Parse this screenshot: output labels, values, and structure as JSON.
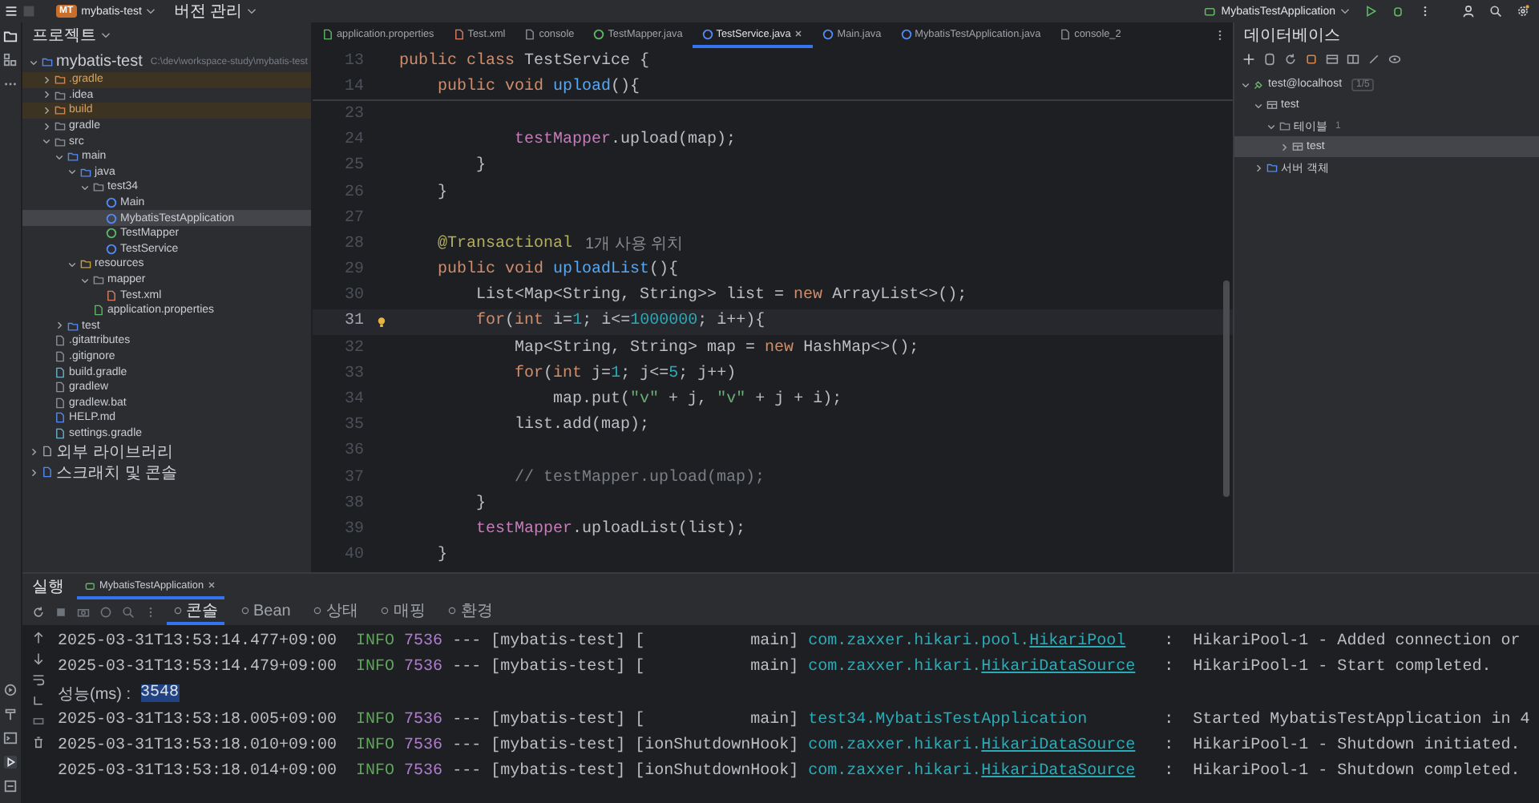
{
  "titlebar": {
    "project_badge": "MT",
    "project_name": "mybatis-test",
    "vcs": "버전 관리",
    "run_config": "MybatisTestApplication"
  },
  "project_panel": {
    "title": "프로젝트",
    "tree": [
      {
        "label": "mybatis-test",
        "hint": "C:\\dev\\workspace-study\\mybatis-test",
        "kind": "module",
        "expanded": true,
        "selected": false,
        "children": [
          {
            "label": ".gradle",
            "kind": "folder",
            "expanded": false,
            "selected": false,
            "excluded": true
          },
          {
            "label": ".idea",
            "kind": "folder",
            "expanded": false,
            "selected": false,
            "excluded": false
          },
          {
            "label": "build",
            "kind": "folder",
            "expanded": false,
            "selected": false,
            "excluded": true
          },
          {
            "label": "gradle",
            "kind": "folder",
            "expanded": false,
            "selected": false,
            "excluded": false
          },
          {
            "label": "src",
            "kind": "folder",
            "expanded": true,
            "selected": false,
            "excluded": false,
            "children": [
              {
                "label": "main",
                "kind": "module",
                "expanded": true,
                "selected": false,
                "children": [
                  {
                    "label": "java",
                    "kind": "source",
                    "expanded": true,
                    "selected": false,
                    "children": [
                      {
                        "label": "test34",
                        "kind": "package",
                        "expanded": true,
                        "selected": false,
                        "children": [
                          {
                            "label": "Main",
                            "kind": "class",
                            "selected": false
                          },
                          {
                            "label": "MybatisTestApplication",
                            "kind": "class",
                            "selected": true
                          },
                          {
                            "label": "TestMapper",
                            "kind": "interface",
                            "selected": false
                          },
                          {
                            "label": "TestService",
                            "kind": "class",
                            "selected": false
                          }
                        ]
                      }
                    ]
                  },
                  {
                    "label": "resources",
                    "kind": "resources",
                    "expanded": true,
                    "selected": false,
                    "children": [
                      {
                        "label": "mapper",
                        "kind": "folder",
                        "expanded": true,
                        "selected": false,
                        "children": [
                          {
                            "label": "Test.xml",
                            "kind": "xml",
                            "selected": false
                          }
                        ]
                      },
                      {
                        "label": "application.properties",
                        "kind": "properties",
                        "selected": false
                      }
                    ]
                  }
                ]
              },
              {
                "label": "test",
                "kind": "module",
                "expanded": false,
                "selected": false
              }
            ]
          },
          {
            "label": ".gitattributes",
            "kind": "file",
            "selected": false,
            "excluded": false
          },
          {
            "label": ".gitignore",
            "kind": "file",
            "selected": false,
            "excluded": false
          },
          {
            "label": "build.gradle",
            "kind": "gradle",
            "selected": false,
            "excluded": false
          },
          {
            "label": "gradlew",
            "kind": "file",
            "selected": false,
            "excluded": false
          },
          {
            "label": "gradlew.bat",
            "kind": "file",
            "selected": false,
            "excluded": false
          },
          {
            "label": "HELP.md",
            "kind": "md",
            "selected": false,
            "excluded": false
          },
          {
            "label": "settings.gradle",
            "kind": "gradle",
            "selected": false,
            "excluded": false
          }
        ]
      },
      {
        "label": "외부 라이브러리",
        "kind": "library",
        "expanded": false,
        "selected": false
      },
      {
        "label": "스크래치 및 콘솔",
        "kind": "scratch",
        "expanded": false,
        "selected": false
      }
    ]
  },
  "editor": {
    "tabs": [
      {
        "label": "application.properties",
        "kind": "properties",
        "selected": false
      },
      {
        "label": "Test.xml",
        "kind": "xml",
        "selected": false
      },
      {
        "label": "console",
        "kind": "console",
        "selected": false
      },
      {
        "label": "TestMapper.java",
        "kind": "interface",
        "selected": false
      },
      {
        "label": "TestService.java",
        "kind": "class",
        "selected": true
      },
      {
        "label": "Main.java",
        "kind": "class",
        "selected": false
      },
      {
        "label": "MybatisTestApplication.java",
        "kind": "class",
        "selected": false
      },
      {
        "label": "console_2",
        "kind": "console",
        "selected": false
      }
    ],
    "sticky_lines": [
      {
        "no": "13",
        "current": false,
        "tokens": [
          {
            "kind": "kw",
            "text": "public class "
          },
          {
            "kind": "plain",
            "text": "TestService {"
          }
        ]
      },
      {
        "no": "14",
        "current": false,
        "tokens": [
          {
            "kind": "kw",
            "text": "    public void "
          },
          {
            "kind": "fn",
            "text": "upload"
          },
          {
            "kind": "plain",
            "text": "(){"
          }
        ]
      }
    ],
    "lines": [
      {
        "no": "23",
        "current": false
      },
      {
        "no": "24",
        "current": false,
        "tokens": [
          {
            "kind": "field",
            "text": "            testMapper"
          },
          {
            "kind": "plain",
            "text": ".upload(map);"
          }
        ]
      },
      {
        "no": "25",
        "current": false,
        "tokens": [
          {
            "kind": "plain",
            "text": "        }"
          }
        ]
      },
      {
        "no": "26",
        "current": false,
        "tokens": [
          {
            "kind": "plain",
            "text": "    }"
          }
        ]
      },
      {
        "no": "27",
        "current": false
      },
      {
        "no": "28",
        "current": false,
        "tokens": [
          {
            "kind": "ann",
            "text": "    @Transactional"
          },
          {
            "kind": "hint",
            "text": "1개 사용 위치"
          }
        ]
      },
      {
        "no": "29",
        "current": false,
        "tokens": [
          {
            "kind": "kw",
            "text": "    public void "
          },
          {
            "kind": "fn",
            "text": "uploadList"
          },
          {
            "kind": "plain",
            "text": "(){"
          }
        ]
      },
      {
        "no": "30",
        "current": false,
        "tokens": [
          {
            "kind": "plain",
            "text": "        List<Map<String, String>> list = "
          },
          {
            "kind": "kw",
            "text": "new "
          },
          {
            "kind": "plain",
            "text": "ArrayList<>();"
          }
        ]
      },
      {
        "no": "31",
        "current": true,
        "tokens": [
          {
            "kind": "kw",
            "text": "        for"
          },
          {
            "kind": "plain",
            "text": "("
          },
          {
            "kind": "kw",
            "text": "int "
          },
          {
            "kind": "plain",
            "text": "i="
          },
          {
            "kind": "num",
            "text": "1"
          },
          {
            "kind": "plain",
            "text": "; i<="
          },
          {
            "kind": "num",
            "text": "1000000"
          },
          {
            "kind": "plain",
            "text": "; i++){"
          }
        ]
      },
      {
        "no": "32",
        "current": false,
        "tokens": [
          {
            "kind": "plain",
            "text": "            Map<String, String> map = "
          },
          {
            "kind": "kw",
            "text": "new "
          },
          {
            "kind": "plain",
            "text": "HashMap<>();"
          }
        ]
      },
      {
        "no": "33",
        "current": false,
        "tokens": [
          {
            "kind": "kw",
            "text": "            for"
          },
          {
            "kind": "plain",
            "text": "("
          },
          {
            "kind": "kw",
            "text": "int "
          },
          {
            "kind": "plain",
            "text": "j="
          },
          {
            "kind": "num",
            "text": "1"
          },
          {
            "kind": "plain",
            "text": "; j<="
          },
          {
            "kind": "num",
            "text": "5"
          },
          {
            "kind": "plain",
            "text": "; j++)"
          }
        ]
      },
      {
        "no": "34",
        "current": false,
        "tokens": [
          {
            "kind": "plain",
            "text": "                map.put("
          },
          {
            "kind": "str",
            "text": "\"v\""
          },
          {
            "kind": "plain",
            "text": " + j, "
          },
          {
            "kind": "str",
            "text": "\"v\""
          },
          {
            "kind": "plain",
            "text": " + j + i);"
          }
        ]
      },
      {
        "no": "35",
        "current": false,
        "tokens": [
          {
            "kind": "plain",
            "text": "            list.add(map);"
          }
        ]
      },
      {
        "no": "36",
        "current": false
      },
      {
        "no": "37",
        "current": false,
        "tokens": [
          {
            "kind": "comment",
            "text": "            // testMapper.upload(map);"
          }
        ]
      },
      {
        "no": "38",
        "current": false,
        "tokens": [
          {
            "kind": "plain",
            "text": "        }"
          }
        ]
      },
      {
        "no": "39",
        "current": false,
        "tokens": [
          {
            "kind": "field",
            "text": "        testMapper"
          },
          {
            "kind": "plain",
            "text": ".uploadList(list);"
          }
        ]
      },
      {
        "no": "40",
        "current": false,
        "tokens": [
          {
            "kind": "plain",
            "text": "    }"
          }
        ]
      }
    ]
  },
  "database_panel": {
    "title": "데이터베이스",
    "tree": [
      {
        "label": "test@localhost",
        "badge": "1/5",
        "kind": "datasource",
        "expanded": true,
        "selected": false,
        "children": [
          {
            "label": "test",
            "kind": "schema",
            "expanded": true,
            "selected": false,
            "children": [
              {
                "label": "테이블",
                "count": "1",
                "kind": "folder",
                "expanded": true,
                "selected": false,
                "children": [
                  {
                    "label": "test",
                    "kind": "table",
                    "expanded": false,
                    "selected": true
                  }
                ]
              }
            ]
          },
          {
            "label": "서버 객체",
            "kind": "server",
            "expanded": false,
            "selected": false
          }
        ]
      }
    ]
  },
  "run_panel": {
    "title": "실행",
    "tabs": [
      {
        "label": "MybatisTestApplication",
        "selected": true
      }
    ],
    "views": [
      {
        "label": "콘솔",
        "selected": true
      },
      {
        "label": "Bean",
        "selected": false
      },
      {
        "label": "상태",
        "selected": false
      },
      {
        "label": "매핑",
        "selected": false
      },
      {
        "label": "환경",
        "selected": false
      }
    ],
    "console": [
      {
        "kind": "log",
        "timestamp": "2025-03-31T13:53:14.477+09:00",
        "level": "INFO",
        "pid": "7536",
        "sep": "---",
        "app": "[mybatis-test]",
        "thread": "[           main]",
        "logger_package": "com.zaxxer.hikari.pool.",
        "logger_class": "HikariPool",
        "link": true,
        "colon": ":",
        "message": "HikariPool-1 - Added connection or"
      },
      {
        "kind": "log",
        "timestamp": "2025-03-31T13:53:14.479+09:00",
        "level": "INFO",
        "pid": "7536",
        "sep": "---",
        "app": "[mybatis-test]",
        "thread": "[           main]",
        "logger_package": "com.zaxxer.hikari.",
        "logger_class": "HikariDataSource",
        "link": true,
        "colon": ":",
        "message": "HikariPool-1 - Start completed."
      },
      {
        "kind": "output",
        "text": "성능(ms) :",
        "highlight": "3548"
      },
      {
        "kind": "log",
        "timestamp": "2025-03-31T13:53:18.005+09:00",
        "level": "INFO",
        "pid": "7536",
        "sep": "---",
        "app": "[mybatis-test]",
        "thread": "[           main]",
        "logger_package": "test34.",
        "logger_class": "MybatisTestApplication",
        "link": false,
        "colon": ":",
        "message": "Started MybatisTestApplication in 4"
      },
      {
        "kind": "log",
        "timestamp": "2025-03-31T13:53:18.010+09:00",
        "level": "INFO",
        "pid": "7536",
        "sep": "---",
        "app": "[mybatis-test]",
        "thread": "[ionShutdownHook]",
        "logger_package": "com.zaxxer.hikari.",
        "logger_class": "HikariDataSource",
        "link": true,
        "colon": ":",
        "message": "HikariPool-1 - Shutdown initiated."
      },
      {
        "kind": "log",
        "timestamp": "2025-03-31T13:53:18.014+09:00",
        "level": "INFO",
        "pid": "7536",
        "sep": "---",
        "app": "[mybatis-test]",
        "thread": "[ionShutdownHook]",
        "logger_package": "com.zaxxer.hikari.",
        "logger_class": "HikariDataSource",
        "link": true,
        "colon": ":",
        "message": "HikariPool-1 - Shutdown completed."
      }
    ]
  }
}
